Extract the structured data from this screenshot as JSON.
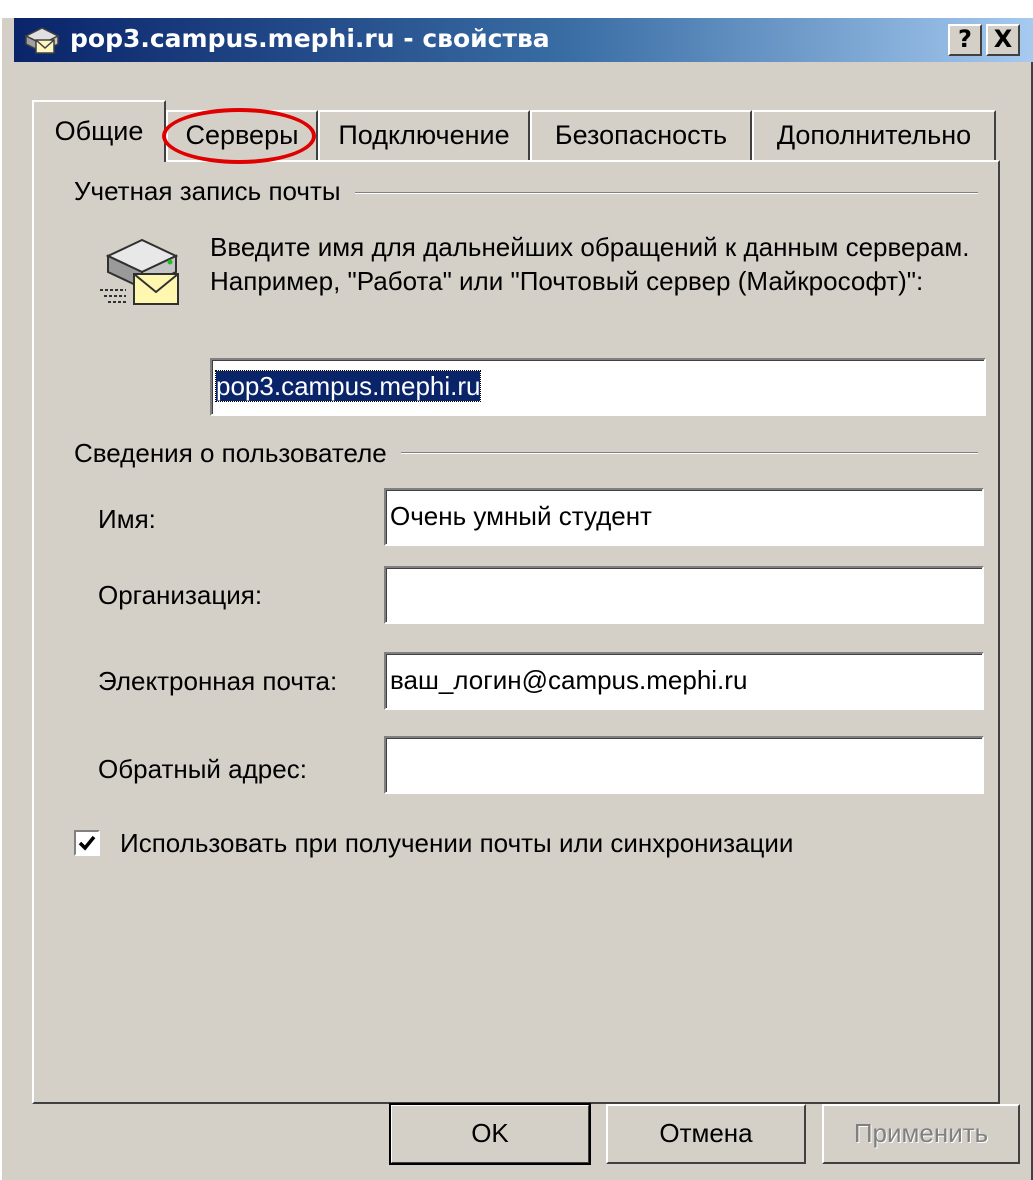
{
  "window": {
    "title": "pop3.campus.mephi.ru - свойства",
    "help_glyph": "?",
    "close_glyph": "X"
  },
  "tabs": [
    {
      "label": "Общие",
      "active": true
    },
    {
      "label": "Серверы",
      "highlighted": true
    },
    {
      "label": "Подключение"
    },
    {
      "label": "Безопасность"
    },
    {
      "label": "Дополнительно"
    }
  ],
  "account": {
    "group_title": "Учетная запись почты",
    "description": "Введите имя для дальнейших обращений к данным серверам. Например, \"Работа\" или \"Почтовый сервер (Майкрософт)\":",
    "name_value": "pop3.campus.mephi.ru",
    "icon": "mail-server-icon"
  },
  "user": {
    "group_title": "Сведения о пользователе",
    "name_label": "Имя:",
    "name_value": "Очень умный студент",
    "org_label": "Организация:",
    "org_value": "",
    "email_label": "Электронная почта:",
    "email_value": "ваш_логин@campus.mephi.ru",
    "reply_label": "Обратный адрес:",
    "reply_value": ""
  },
  "checkbox": {
    "label": "Использовать при получении почты или синхронизации",
    "checked": true
  },
  "buttons": {
    "ok": "OK",
    "cancel": "Отмена",
    "apply": "Применить"
  },
  "colors": {
    "title_start": "#0a246a",
    "title_end": "#a6caf0",
    "face": "#d4d0c8",
    "highlight_oval": "#e00000"
  }
}
